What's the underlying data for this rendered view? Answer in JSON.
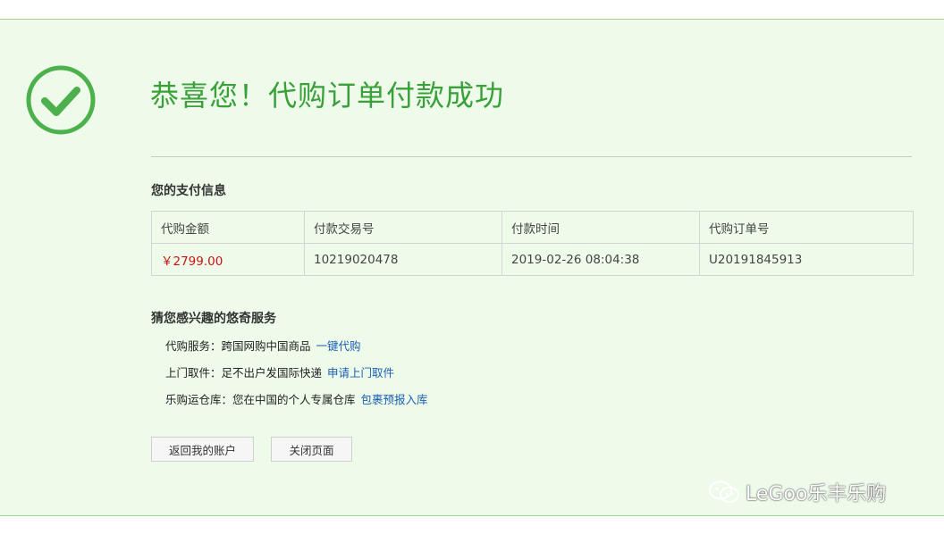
{
  "header": {
    "title": "恭喜您！代购订单付款成功"
  },
  "payment": {
    "section_title": "您的支付信息",
    "columns": [
      "代购金额",
      "付款交易号",
      "付款时间",
      "代购订单号"
    ],
    "rows": [
      [
        "￥2799.00",
        "10219020478",
        "2019-02-26 08:04:38",
        "U20191845913"
      ]
    ]
  },
  "services": {
    "section_title": "猜您感兴趣的悠奇服务",
    "items": [
      {
        "text": "代购服务：跨国网购中国商品",
        "link": "一键代购"
      },
      {
        "text": "上门取件：足不出户发国际快递",
        "link": "申请上门取件"
      },
      {
        "text": "乐购运仓库：您在中国的个人专属仓库",
        "link": "包裹预报入库"
      }
    ]
  },
  "actions": {
    "back_label": "返回我的账户",
    "close_label": "关闭页面"
  },
  "watermark": {
    "text": "LeGoo乐丰乐购",
    "icon": "wechat-icon"
  },
  "colors": {
    "success_green": "#3aa03a",
    "panel_bg": "#eefbea",
    "amount_red": "#c81414",
    "link_blue": "#1a5fb4"
  }
}
